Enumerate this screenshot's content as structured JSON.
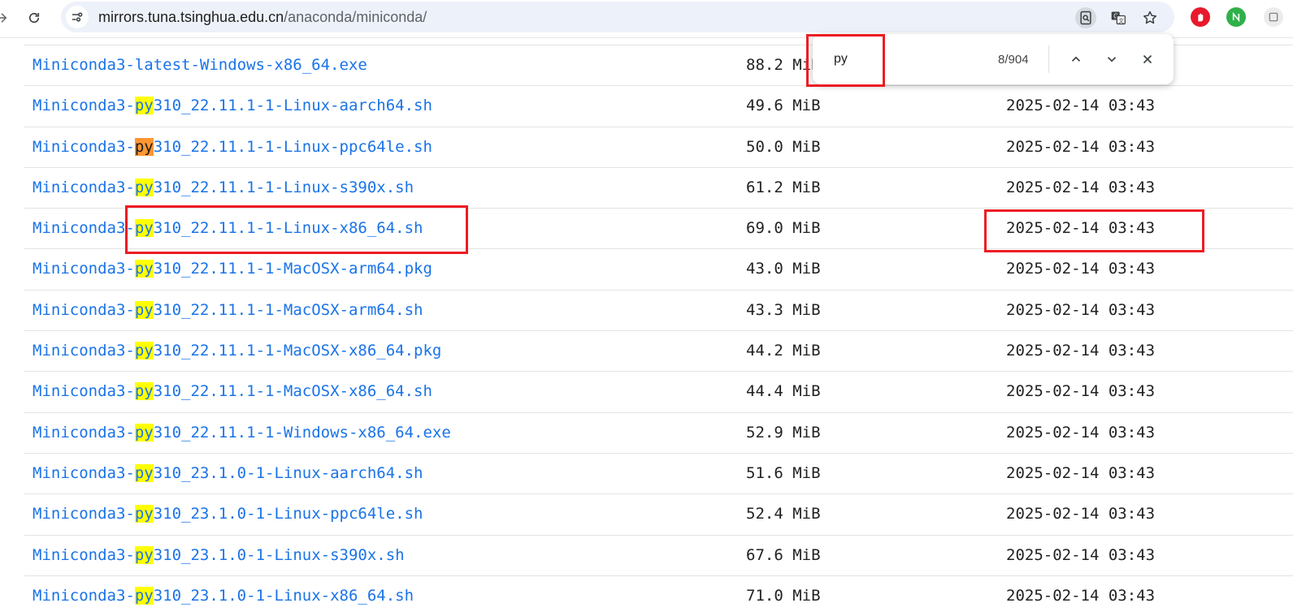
{
  "browser": {
    "url_host": "mirrors.tuna.tsinghua.edu.cn",
    "url_path": "/anaconda/miniconda/",
    "icons": [
      "back-arrow-icon",
      "reload-icon",
      "site-info-icon",
      "page-search-icon",
      "translate-icon",
      "bookmark-star-icon",
      "adblock-extension-icon",
      "n-extension-icon",
      "extension-menu-icon"
    ]
  },
  "find": {
    "query": "py",
    "count": "8/904"
  },
  "files": [
    {
      "prefix": "Miniconda3-latest-Windows-x86_64.exe",
      "match": "",
      "rest": "",
      "size": "88.2 MiB",
      "date": ""
    },
    {
      "prefix": "Miniconda3-",
      "match": "py",
      "rest": "310_22.11.1-1-Linux-aarch64.sh",
      "size": "49.6 MiB",
      "date": "2025-02-14 03:43"
    },
    {
      "prefix": "Miniconda3-",
      "match": "py",
      "rest": "310_22.11.1-1-Linux-ppc64le.sh",
      "size": "50.0 MiB",
      "date": "2025-02-14 03:43",
      "current": true
    },
    {
      "prefix": "Miniconda3-",
      "match": "py",
      "rest": "310_22.11.1-1-Linux-s390x.sh",
      "size": "61.2 MiB",
      "date": "2025-02-14 03:43"
    },
    {
      "prefix": "Miniconda3-",
      "match": "py",
      "rest": "310_22.11.1-1-Linux-x86_64.sh",
      "size": "69.0 MiB",
      "date": "2025-02-14 03:43"
    },
    {
      "prefix": "Miniconda3-",
      "match": "py",
      "rest": "310_22.11.1-1-MacOSX-arm64.pkg",
      "size": "43.0 MiB",
      "date": "2025-02-14 03:43"
    },
    {
      "prefix": "Miniconda3-",
      "match": "py",
      "rest": "310_22.11.1-1-MacOSX-arm64.sh",
      "size": "43.3 MiB",
      "date": "2025-02-14 03:43"
    },
    {
      "prefix": "Miniconda3-",
      "match": "py",
      "rest": "310_22.11.1-1-MacOSX-x86_64.pkg",
      "size": "44.2 MiB",
      "date": "2025-02-14 03:43"
    },
    {
      "prefix": "Miniconda3-",
      "match": "py",
      "rest": "310_22.11.1-1-MacOSX-x86_64.sh",
      "size": "44.4 MiB",
      "date": "2025-02-14 03:43"
    },
    {
      "prefix": "Miniconda3-",
      "match": "py",
      "rest": "310_22.11.1-1-Windows-x86_64.exe",
      "size": "52.9 MiB",
      "date": "2025-02-14 03:43"
    },
    {
      "prefix": "Miniconda3-",
      "match": "py",
      "rest": "310_23.1.0-1-Linux-aarch64.sh",
      "size": "51.6 MiB",
      "date": "2025-02-14 03:43"
    },
    {
      "prefix": "Miniconda3-",
      "match": "py",
      "rest": "310_23.1.0-1-Linux-ppc64le.sh",
      "size": "52.4 MiB",
      "date": "2025-02-14 03:43"
    },
    {
      "prefix": "Miniconda3-",
      "match": "py",
      "rest": "310_23.1.0-1-Linux-s390x.sh",
      "size": "67.6 MiB",
      "date": "2025-02-14 03:43"
    },
    {
      "prefix": "Miniconda3-",
      "match": "py",
      "rest": "310_23.1.0-1-Linux-x86_64.sh",
      "size": "71.0 MiB",
      "date": "2025-02-14 03:43"
    }
  ],
  "colors": {
    "link": "#1a73e8",
    "match_highlight": "#ffff00",
    "current_match_highlight": "#ff9632",
    "annotation_red": "#ec1c24"
  }
}
